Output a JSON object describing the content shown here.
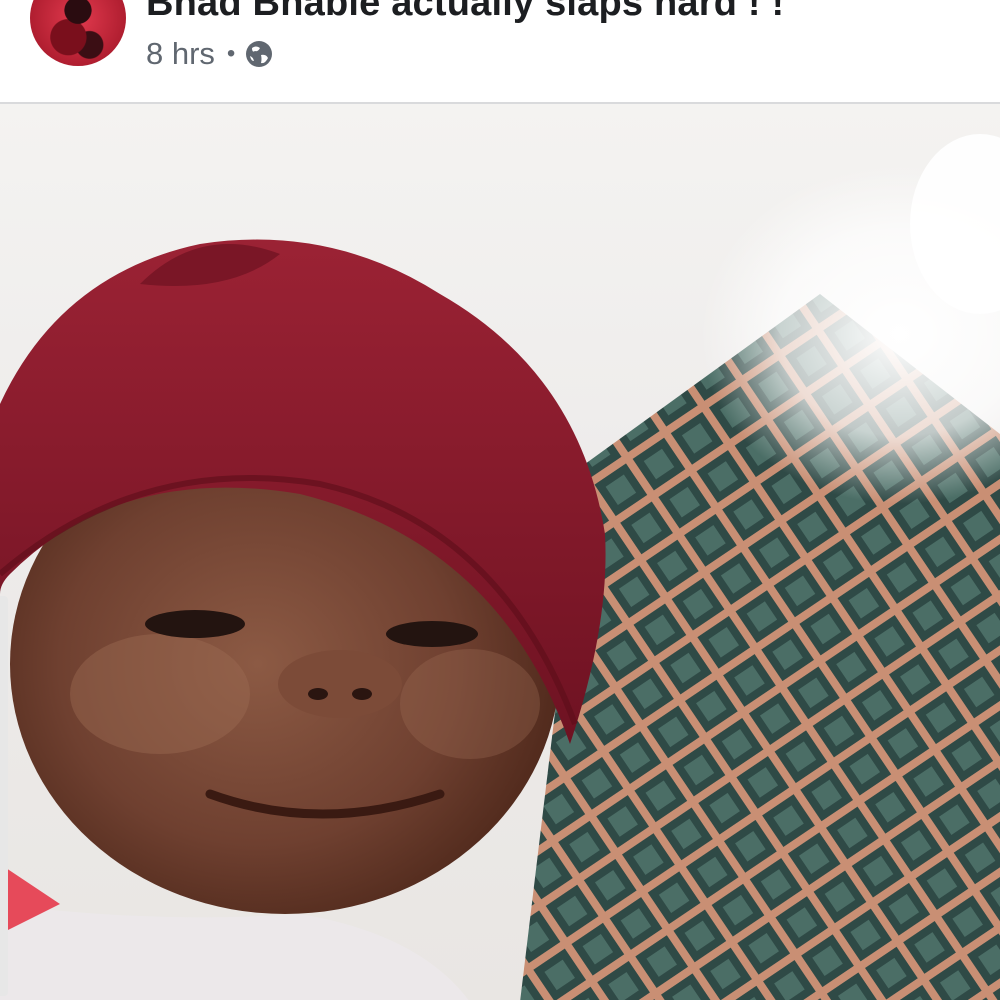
{
  "post": {
    "author_line": "Bhad Bhabie actually slaps hard ! !",
    "time": "8 hrs",
    "separator": "•",
    "privacy_icon": "globe-icon"
  },
  "photo": {
    "subject": "baby-in-red-beanie"
  },
  "colors": {
    "author": "#1c1e21",
    "meta": "#606770",
    "beanie": "#8e1c2e"
  }
}
